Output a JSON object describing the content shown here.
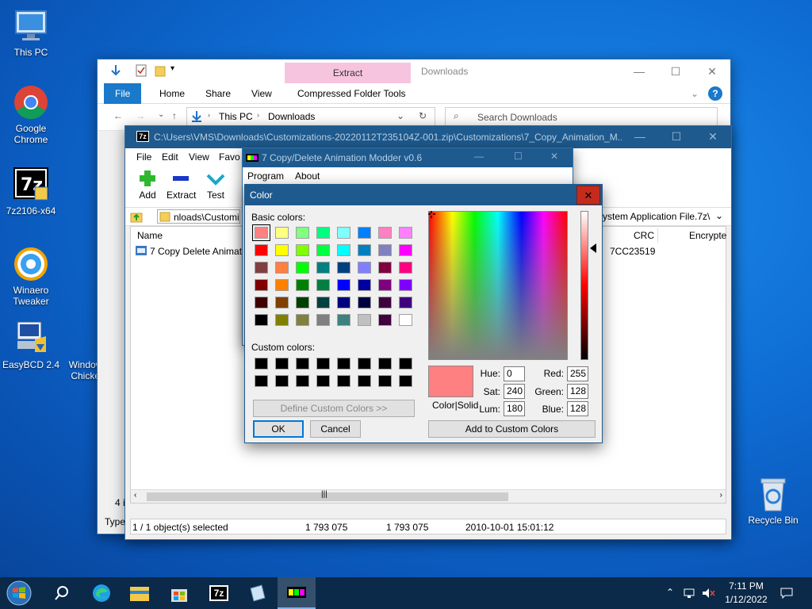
{
  "desktop": {
    "icons": [
      {
        "label": "This PC"
      },
      {
        "label": "Google Chrome"
      },
      {
        "label": "7z2106-x64"
      },
      {
        "label": "Winaero Tweaker"
      },
      {
        "label": "EasyBCD 2.4"
      },
      {
        "label": "Windows Chicken"
      },
      {
        "label": "Recycle Bin"
      }
    ]
  },
  "explorer": {
    "title": "Downloads",
    "context_tab": "Extract",
    "ribbon_tabs": [
      "File",
      "Home",
      "Share",
      "View",
      "Compressed Folder Tools"
    ],
    "breadcrumb": [
      "This PC",
      "Downloads"
    ],
    "search_placeholder": "Search Downloads",
    "side_count": "4 i"
  },
  "sevenzip": {
    "title": "C:\\Users\\VMS\\Downloads\\Customizations-20220112T235104Z-001.zip\\Customizations\\7_Copy_Animation_M...",
    "menu": [
      "File",
      "Edit",
      "View",
      "Favo"
    ],
    "tools": [
      "Add",
      "Extract",
      "Test"
    ],
    "path": "nloads\\Customi",
    "path_right": "ystem Application File.7z\\",
    "columns": {
      "name": "Name",
      "crc": "CRC",
      "encrypted": "Encrypte"
    },
    "rows": [
      {
        "name": "7 Copy Delete Animat",
        "crc": "7CC23519"
      }
    ],
    "status": {
      "selected": "1 / 1 object(s) selected",
      "size": "1 793 075",
      "packed": "1 793 075",
      "modified": "2010-10-01 15:01:12",
      "type_cut": "Type"
    }
  },
  "modder": {
    "title": "7 Copy/Delete Animation Modder v0.6",
    "menu": [
      "Program",
      "About"
    ]
  },
  "color_dialog": {
    "title": "Color",
    "basic_label": "Basic colors:",
    "custom_label": "Custom colors:",
    "define_button": "Define Custom Colors >>",
    "ok": "OK",
    "cancel": "Cancel",
    "add_custom": "Add to Custom Colors",
    "color_solid": "Color|Solid",
    "basic_colors": [
      "#ff8080",
      "#ffff80",
      "#80ff80",
      "#00ff80",
      "#80ffff",
      "#0080ff",
      "#ff80c0",
      "#ff80ff",
      "#ff0000",
      "#ffff00",
      "#80ff00",
      "#00ff40",
      "#00ffff",
      "#0080c0",
      "#8080c0",
      "#ff00ff",
      "#804040",
      "#ff8040",
      "#00ff00",
      "#008080",
      "#004080",
      "#8080ff",
      "#800040",
      "#ff0080",
      "#800000",
      "#ff8000",
      "#008000",
      "#008040",
      "#0000ff",
      "#0000a0",
      "#800080",
      "#8000ff",
      "#400000",
      "#804000",
      "#004000",
      "#004040",
      "#000080",
      "#000040",
      "#400040",
      "#400080",
      "#000000",
      "#808000",
      "#808040",
      "#808080",
      "#408080",
      "#c0c0c0",
      "#400040",
      "#ffffff"
    ],
    "selected_color": "#ff8080",
    "hue_label": "Hue:",
    "hue": "0",
    "sat_label": "Sat:",
    "sat": "240",
    "lum_label": "Lum:",
    "lum": "180",
    "red_label": "Red:",
    "red": "255",
    "green_label": "Green:",
    "green": "128",
    "blue_label": "Blue:",
    "blue": "128"
  },
  "taskbar": {
    "time": "7:11 PM",
    "date": "1/12/2022",
    "app_7z": "7z"
  }
}
